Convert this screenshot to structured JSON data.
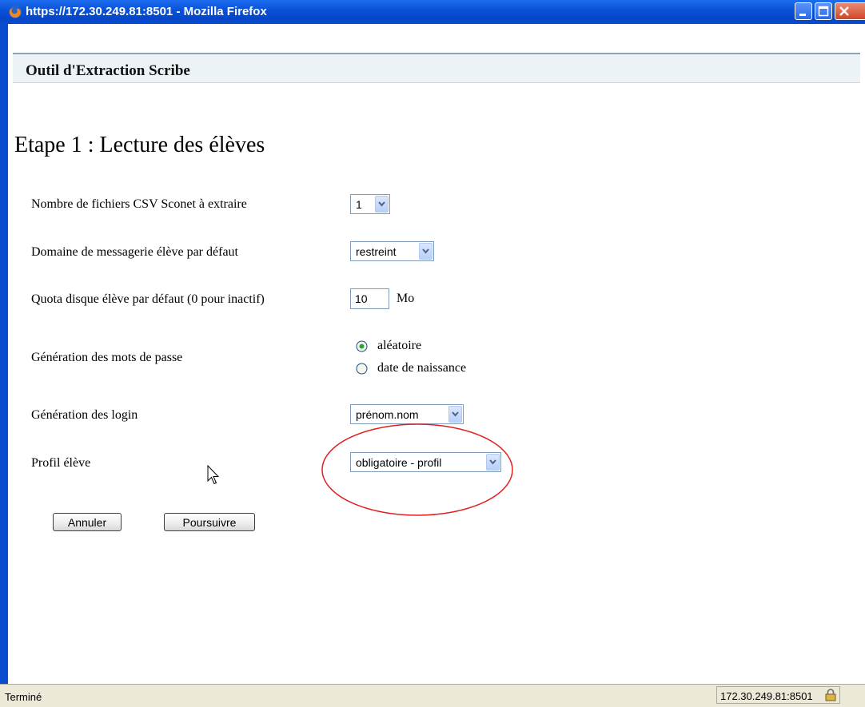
{
  "window": {
    "title": "https://172.30.249.81:8501 - Mozilla Firefox"
  },
  "header": {
    "app_title": "Outil d'Extraction Scribe"
  },
  "page": {
    "title": "Etape 1 : Lecture des élèves"
  },
  "form": {
    "csv_count": {
      "label": "Nombre de fichiers CSV Sconet à extraire",
      "value": "1"
    },
    "mail_domain": {
      "label": "Domaine de messagerie élève par défaut",
      "value": "restreint"
    },
    "quota": {
      "label": "Quota disque élève par défaut (0 pour inactif)",
      "value": "10",
      "unit": "Mo"
    },
    "password": {
      "label": "Génération des mots de passe",
      "options": [
        "aléatoire",
        "date de naissance"
      ],
      "selected": "aléatoire"
    },
    "login": {
      "label": "Génération des login",
      "value": "prénom.nom"
    },
    "profile": {
      "label": "Profil élève",
      "value": "obligatoire - profil"
    }
  },
  "buttons": {
    "cancel": "Annuler",
    "continue": "Poursuivre"
  },
  "status": {
    "text": "Terminé",
    "url": "172.30.249.81:8501"
  },
  "colors": {
    "titlebar": "#0a4cd0",
    "annotation": "#e02020",
    "header_bg": "#ecf3f6"
  },
  "icons": {
    "browser": "firefox-icon",
    "status_lock": "lock-icon"
  }
}
